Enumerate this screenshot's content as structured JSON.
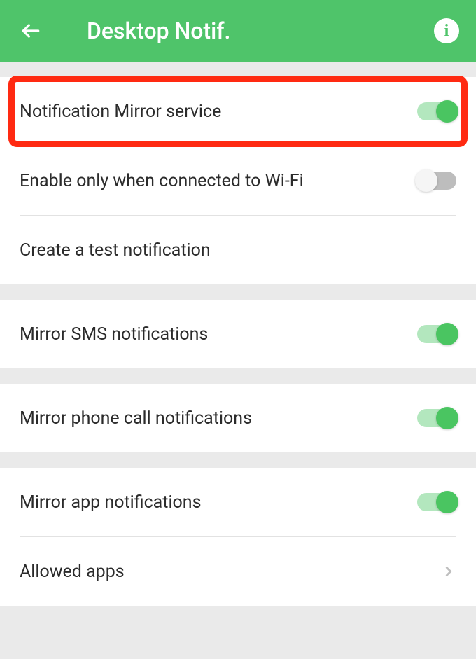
{
  "header": {
    "title": "Desktop Notif."
  },
  "settings": {
    "mirror_service": {
      "label": "Notification Mirror service",
      "enabled": true
    },
    "wifi_only": {
      "label": "Enable only when connected to Wi-Fi",
      "enabled": false
    },
    "create_test": {
      "label": "Create a test notification"
    },
    "mirror_sms": {
      "label": "Mirror SMS notifications",
      "enabled": true
    },
    "mirror_phone": {
      "label": "Mirror phone call notifications",
      "enabled": true
    },
    "mirror_app": {
      "label": "Mirror app notifications",
      "enabled": true
    },
    "allowed_apps": {
      "label": "Allowed apps"
    }
  }
}
